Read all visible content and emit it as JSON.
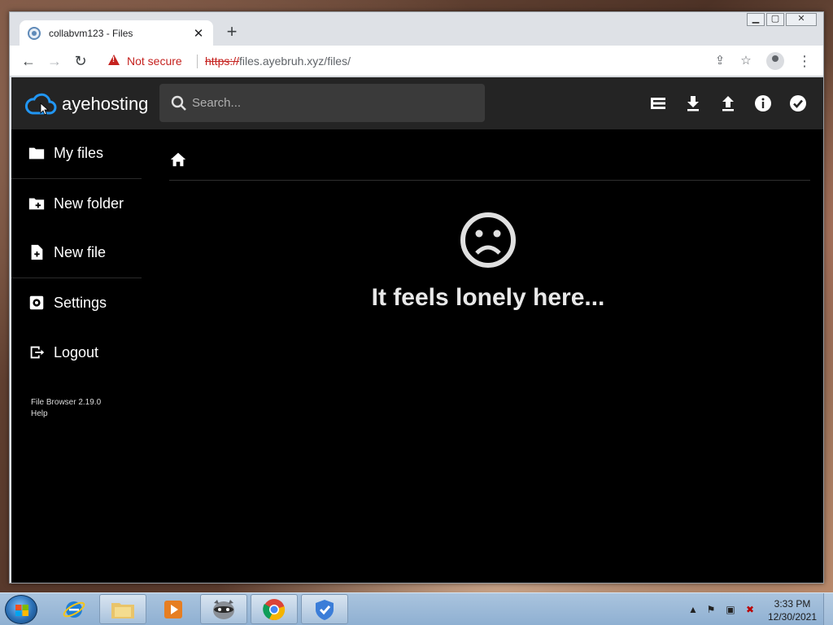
{
  "browser": {
    "tab_title": "collabvm123 - Files",
    "tab_close_glyph": "✕",
    "new_tab_glyph": "+",
    "security_label": "Not secure",
    "url_scheme": "https://",
    "url_rest": "files.ayebruh.xyz/files/"
  },
  "app": {
    "brand": "ayehosting",
    "search_placeholder": "Search...",
    "header_actions": [
      "list-view-icon",
      "download-icon",
      "upload-icon",
      "info-icon",
      "check-circle-icon"
    ]
  },
  "sidebar": {
    "items": [
      {
        "label": "My files",
        "icon": "folder-icon"
      },
      {
        "label": "New folder",
        "icon": "new-folder-icon"
      },
      {
        "label": "New file",
        "icon": "new-file-icon"
      },
      {
        "label": "Settings",
        "icon": "settings-icon"
      },
      {
        "label": "Logout",
        "icon": "logout-icon"
      }
    ],
    "footer_version": "File Browser 2.19.0",
    "footer_help": "Help"
  },
  "main": {
    "breadcrumb_icon": "home-icon",
    "empty_message": "It feels lonely here...",
    "empty_icon": "sad-face-icon"
  },
  "taskbar": {
    "pinned": [
      "internet-explorer-icon",
      "file-explorer-icon",
      "media-player-icon",
      "raccoon-app-icon",
      "chrome-icon",
      "security-app-icon"
    ],
    "time": "3:33 PM",
    "date": "12/30/2021"
  },
  "colors": {
    "app_header_bg": "#242424",
    "app_bg": "#000000",
    "brand_blue": "#2196f3",
    "warning_red": "#c5221f"
  }
}
